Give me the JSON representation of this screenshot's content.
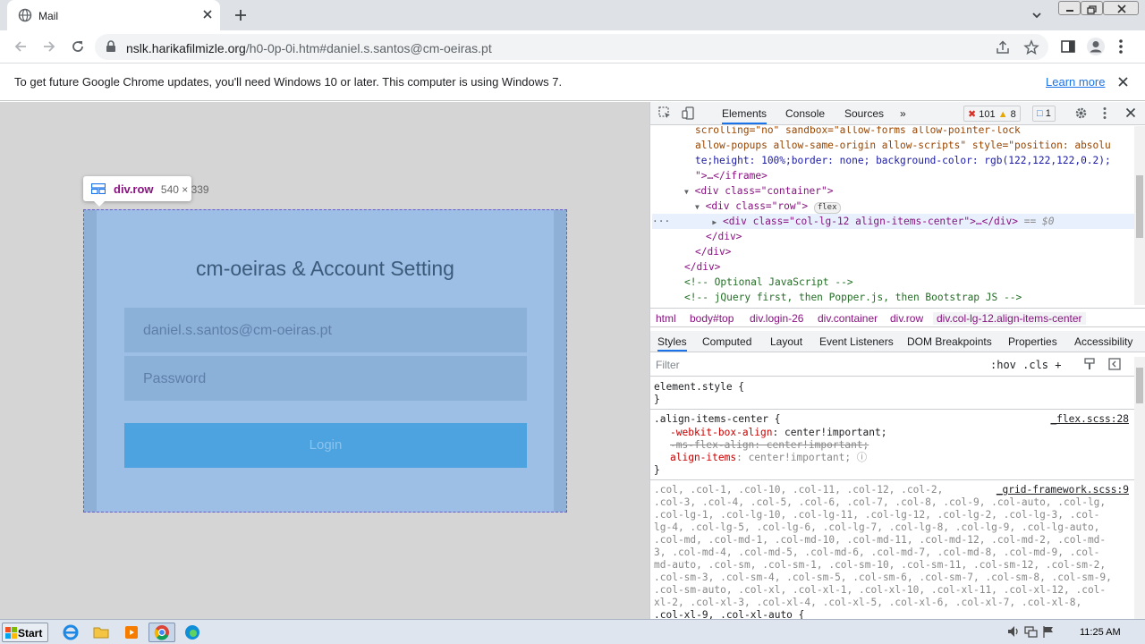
{
  "browser": {
    "tab_title": "Mail",
    "url_domain": "nslk.harikafilmizle.org",
    "url_path": "/h0-0p-0i.htm#daniel.s.santos@cm-oeiras.pt"
  },
  "infobar": {
    "message": "To get future Google Chrome updates, you'll need Windows 10 or later. This computer is using Windows 7.",
    "learn_more": "Learn more"
  },
  "page": {
    "inspect_tooltip": {
      "selector": "div.row",
      "dimensions": "540 × 339"
    },
    "heading": "cm-oeiras & Account Setting",
    "email_value": "daniel.s.santos@cm-oeiras.pt",
    "password_placeholder": "Password",
    "login_button": "Login"
  },
  "devtools": {
    "tabs": [
      "Elements",
      "Console",
      "Sources",
      "»"
    ],
    "error_count": "101",
    "warning_count": "8",
    "message_count": "1",
    "dom_lines": {
      "l1_a": "scrolling=\"no\" sandbox=\"allow-forms allow-pointer-lock",
      "l2_a": "allow-popups allow-same-origin allow-scripts\" style=\"position: absolu",
      "l3_a": "te;height: 100%;border: none; background-color: rgb(122,122,122,0.2);",
      "l4_a": "\">…</iframe>",
      "l5": "<div class=\"container\">",
      "l6": "<div class=\"row\">",
      "l6_badge": "flex",
      "l7": "<div class=\"col-lg-12 align-items-center\">…</div>",
      "l7_suffix": "== $0",
      "l8": "</div>",
      "l9": "</div>",
      "l10": "</div>",
      "l11": "<!-- Optional JavaScript -->",
      "l12": "<!-- jQuery first, then Popper.js, then Bootstrap JS -->"
    },
    "breadcrumbs": [
      "html",
      "body#top",
      "div.login-26",
      "div.container",
      "div.row",
      "div.col-lg-12.align-items-center"
    ],
    "subtabs": [
      "Styles",
      "Computed",
      "Layout",
      "Event Listeners",
      "DOM Breakpoints",
      "Properties",
      "Accessibility"
    ],
    "filter_placeholder": "Filter",
    "filter_tools": ":hov  .cls  +",
    "styles": {
      "element_style": "element.style {",
      "close_brace": "}",
      "rule1_selector": ".align-items-center {",
      "rule1_source": "_flex.scss:28",
      "rule1_p1_name": "-webkit-box-align",
      "rule1_p1_value": ": center!important;",
      "rule1_p2": "-ms-flex-align: center!important;",
      "rule1_p3_name": "align-items",
      "rule1_p3_value": ": center!important;",
      "rule2_source": "_grid-framework.scss:9",
      "rule2_lines": [
        ".col, .col-1, .col-10, .col-11, .col-12, .col-2,",
        ".col-3, .col-4, .col-5, .col-6, .col-7, .col-8, .col-9, .col-auto, .col-lg,",
        ".col-lg-1, .col-lg-10, .col-lg-11, .col-lg-12, .col-lg-2, .col-lg-3, .col-",
        "lg-4, .col-lg-5, .col-lg-6, .col-lg-7, .col-lg-8, .col-lg-9, .col-lg-auto,",
        ".col-md, .col-md-1, .col-md-10, .col-md-11, .col-md-12, .col-md-2, .col-md-",
        "3, .col-md-4, .col-md-5, .col-md-6, .col-md-7, .col-md-8, .col-md-9, .col-",
        "md-auto, .col-sm, .col-sm-1, .col-sm-10, .col-sm-11, .col-sm-12, .col-sm-2,",
        ".col-sm-3, .col-sm-4, .col-sm-5, .col-sm-6, .col-sm-7, .col-sm-8, .col-sm-9,",
        ".col-sm-auto, .col-xl, .col-xl-1, .col-xl-10, .col-xl-11, .col-xl-12, .col-",
        "xl-2, .col-xl-3, .col-xl-4, .col-xl-5, .col-xl-6, .col-xl-7, .col-xl-8,",
        ".col-xl-9, .col-xl-auto {"
      ]
    }
  },
  "taskbar": {
    "start_label": "Start",
    "clock": "11:25 AM"
  },
  "colors": {
    "chrome_accent": "#1a73e8",
    "highlight_blue": "#9dbfe5",
    "login_button": "#4ca3df",
    "tag_purple": "#881280"
  }
}
